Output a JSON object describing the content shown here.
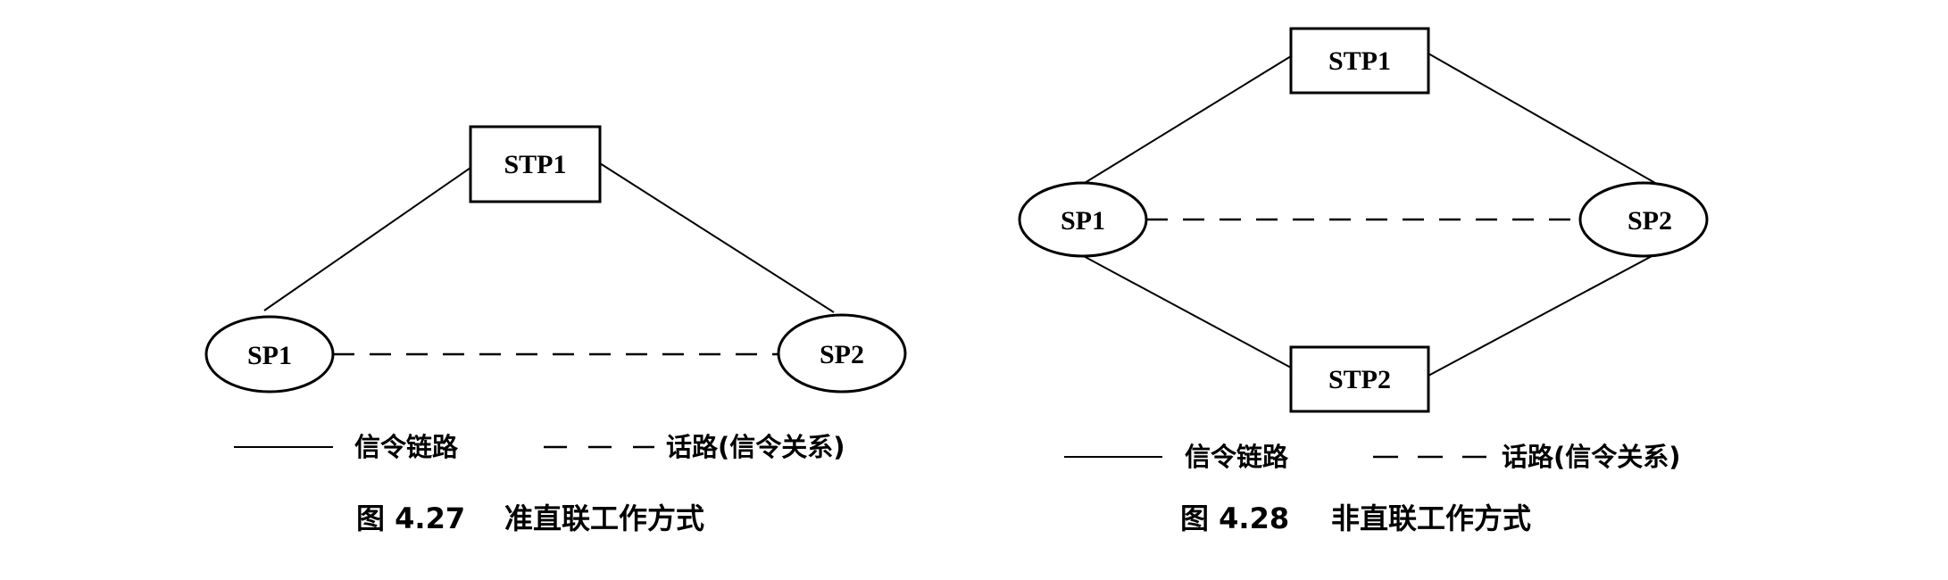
{
  "figures": [
    {
      "nodes": {
        "stp1": "STP1",
        "sp1": "SP1",
        "sp2": "SP2"
      },
      "legend": {
        "solid_label": "信令链路",
        "dashed_label": "话路(信令关系)"
      },
      "caption": {
        "number": "图 4.27",
        "title": "准直联工作方式"
      }
    },
    {
      "nodes": {
        "stp1": "STP1",
        "stp2": "STP2",
        "sp1": "SP1",
        "sp2": "SP2"
      },
      "legend": {
        "solid_label": "信令链路",
        "dashed_label": "话路(信令关系)"
      },
      "caption": {
        "number": "图 4.28",
        "title": "非直联工作方式"
      }
    }
  ],
  "colors": {
    "line": "#000000",
    "background": "#ffffff"
  }
}
